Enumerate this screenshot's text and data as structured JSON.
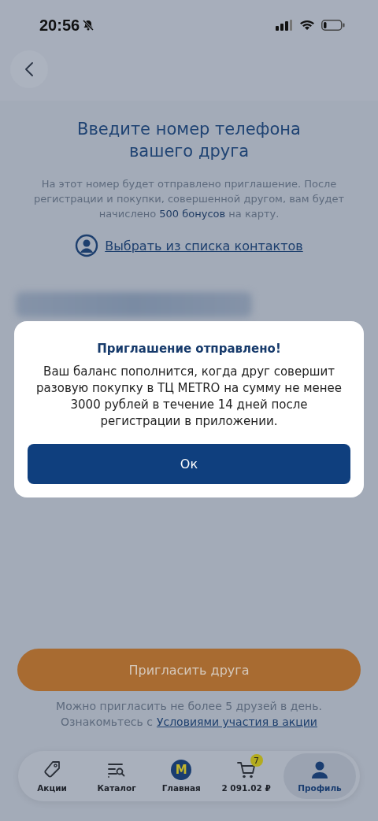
{
  "status_bar": {
    "time": "20:56",
    "silent": true
  },
  "header": {
    "back": true
  },
  "title": "Введите номер телефона вашего друга",
  "description": "На этот номер будет отправлено приглашение. После регистрации и покупки, совершенной другом, вам будет начислено **500 бонусов** на карту.",
  "contacts_link": "Выбрать из списка контактов",
  "phone_field": {
    "blurred": true
  },
  "invite_button": "Пригласить друга",
  "note": "Можно пригласить не более 5 друзей в день.",
  "terms": {
    "prefix": "Ознакомьтесь с",
    "link": "Условиями участия в акции"
  },
  "bottom_nav": [
    {
      "kind": "tag",
      "label": "Акции",
      "selected": false
    },
    {
      "kind": "catalog",
      "label": "Каталог",
      "selected": false
    },
    {
      "kind": "logo",
      "logo_text": "M",
      "label": "Главная",
      "selected": false
    },
    {
      "kind": "cart",
      "badge": "7",
      "label": "2 091.02 ₽",
      "selected": false
    },
    {
      "kind": "profile",
      "label": "Профиль",
      "selected": true
    }
  ],
  "dialog": {
    "title": "Приглашение отправлено!",
    "message": "Ваш баланс пополнится, когда друг совершит разовую покупку в ТЦ METRO на сумму не менее 3000 рублей в течение 14 дней после регистрации в приложении.",
    "button": "Ок"
  }
}
